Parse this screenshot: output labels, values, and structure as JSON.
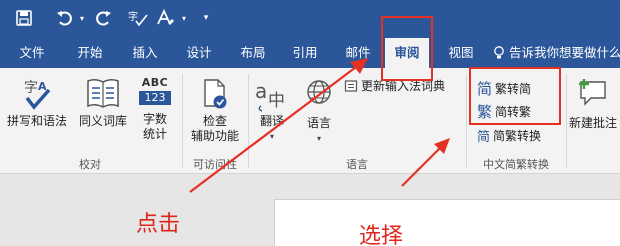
{
  "quick_access": {
    "icons": [
      "save-icon",
      "undo-icon",
      "redo-icon",
      "spelling-icon",
      "format-text-icon",
      "customize-icon"
    ]
  },
  "tabs": [
    {
      "label": "文件"
    },
    {
      "label": "开始"
    },
    {
      "label": "插入"
    },
    {
      "label": "设计"
    },
    {
      "label": "布局"
    },
    {
      "label": "引用"
    },
    {
      "label": "邮件"
    },
    {
      "label": "审阅"
    },
    {
      "label": "视图"
    }
  ],
  "active_tab": "审阅",
  "tell_me": "告诉我你想要做什么",
  "ribbon": {
    "proofing": {
      "spelling": "拼写和语法",
      "thesaurus": "同义词库",
      "word_count_line1": "字数",
      "word_count_line2": "统计",
      "abc_label": "ABC",
      "abc_num": "123",
      "group": "校对"
    },
    "accessibility": {
      "check_line1": "检查",
      "check_line2": "辅助功能",
      "group": "可访问性"
    },
    "language": {
      "translate": "翻译",
      "language": "语言",
      "update_ime": "更新输入法词典",
      "group": "语言"
    },
    "chinese_conversion": {
      "to_traditional": "繁转简",
      "to_simplified": "简转繁",
      "convert": "简繁转换",
      "glyph_simplified": "简",
      "glyph_traditional": "繁",
      "group": "中文简繁转换"
    },
    "comments": {
      "new_comment": "新建批注"
    }
  },
  "annotations": {
    "click": "点击",
    "select": "选择"
  },
  "colors": {
    "accent": "#2b579a",
    "annotation": "#e53024"
  }
}
